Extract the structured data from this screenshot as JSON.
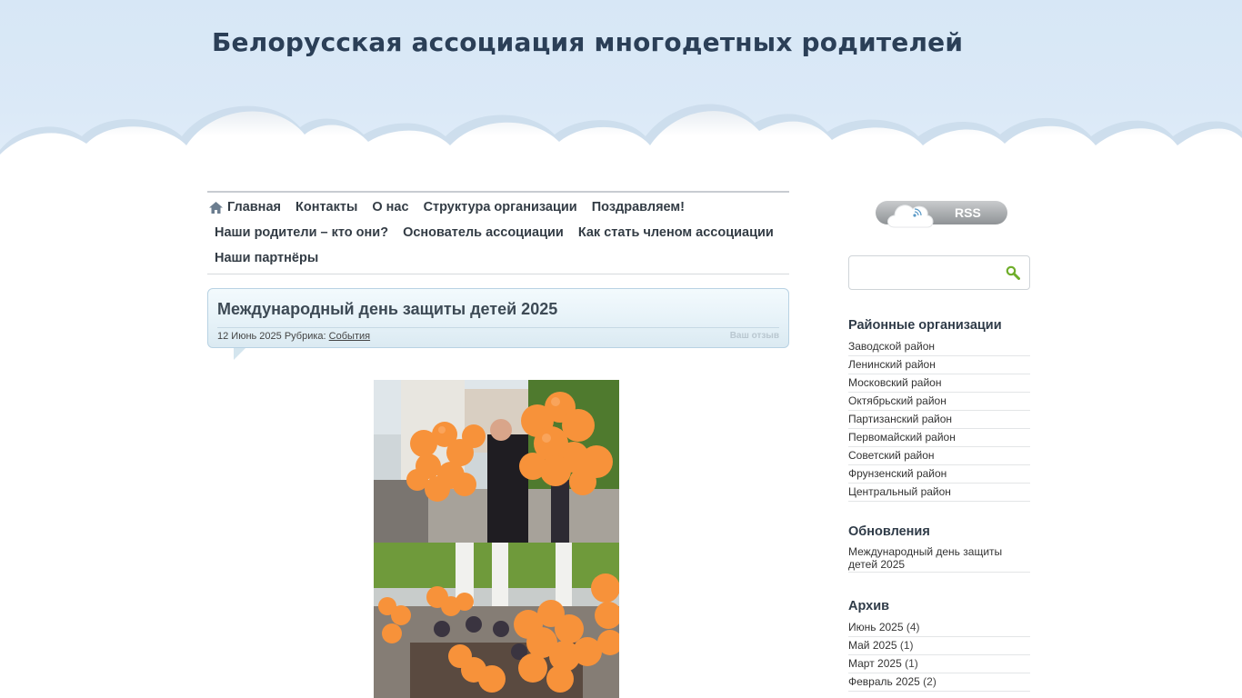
{
  "site": {
    "title": "Белорусская ассоциация многодетных родителей"
  },
  "nav": {
    "row1": [
      "Главная",
      "Контакты",
      "О нас",
      "Структура организации",
      "Поздравляем!"
    ],
    "row2": [
      "Наши родители – кто они?",
      "Основатель ассоциации",
      "Как стать членом ассоциации"
    ],
    "row3": [
      "Наши партнёры"
    ]
  },
  "post": {
    "title": "Международный день защиты детей 2025",
    "date": "12 Июнь 2025",
    "category_label": "Рубрика:",
    "category": "События",
    "feedback": "Ваш отзыв"
  },
  "sidebar": {
    "rss_label": "RSS",
    "search": {
      "value": "",
      "placeholder": ""
    },
    "districts": {
      "title": "Районные организации",
      "items": [
        "Заводской район",
        "Ленинский район",
        "Московский район",
        "Октябрьский район",
        "Партизанский район",
        "Первомайский район",
        "Советский район",
        "Фрунзенский район",
        "Центральный район"
      ]
    },
    "updates": {
      "title": "Обновления",
      "items": [
        "Международный день защиты детей 2025"
      ]
    },
    "archive": {
      "title": "Архив",
      "items": [
        {
          "label": "Июнь 2025",
          "count": "(4)"
        },
        {
          "label": "Май 2025",
          "count": "(1)"
        },
        {
          "label": "Март 2025",
          "count": "(1)"
        },
        {
          "label": "Февраль 2025",
          "count": "(2)"
        }
      ]
    }
  },
  "colors": {
    "sky": "#d7e7f6",
    "title": "#2b3f57",
    "balloon": "#f7923a",
    "accent_green": "#7cb82f"
  }
}
